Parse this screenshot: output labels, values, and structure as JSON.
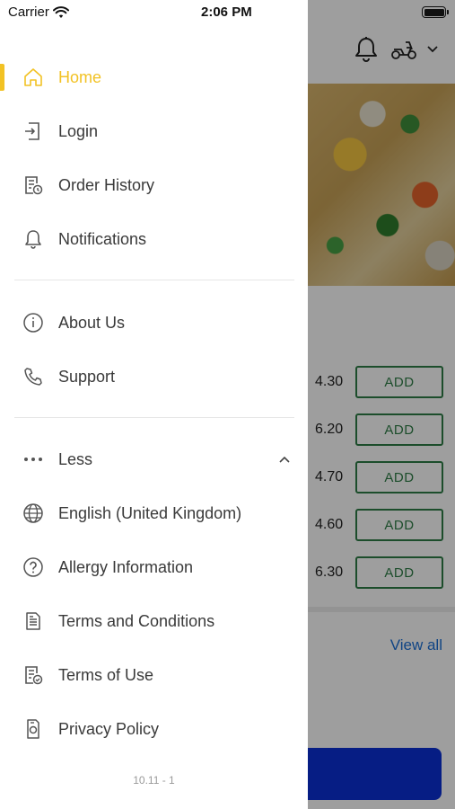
{
  "status_bar": {
    "carrier": "Carrier",
    "time": "2:06 PM"
  },
  "drawer": {
    "primary_items": [
      {
        "id": "home",
        "label": "Home",
        "icon": "home-icon",
        "active": true
      },
      {
        "id": "login",
        "label": "Login",
        "icon": "login-icon",
        "active": false
      },
      {
        "id": "order-history",
        "label": "Order History",
        "icon": "order-history-icon",
        "active": false
      },
      {
        "id": "notifications",
        "label": "Notifications",
        "icon": "bell-icon",
        "active": false
      }
    ],
    "secondary_items": [
      {
        "id": "about-us",
        "label": "About Us",
        "icon": "info-icon"
      },
      {
        "id": "support",
        "label": "Support",
        "icon": "phone-icon"
      }
    ],
    "less_label": "Less",
    "more_items": [
      {
        "id": "language",
        "label": "English (United Kingdom)",
        "icon": "globe-icon"
      },
      {
        "id": "allergy",
        "label": "Allergy Information",
        "icon": "question-icon"
      },
      {
        "id": "terms-conditions",
        "label": "Terms and Conditions",
        "icon": "document-icon"
      },
      {
        "id": "terms-of-use",
        "label": "Terms of Use",
        "icon": "document-check-icon"
      },
      {
        "id": "privacy-policy",
        "label": "Privacy Policy",
        "icon": "privacy-icon"
      }
    ],
    "version": "10.11 - 1",
    "accent_color": "#f2c224"
  },
  "background": {
    "menu_rows": [
      {
        "price": "4.30",
        "button": "ADD"
      },
      {
        "price": "6.20",
        "button": "ADD"
      },
      {
        "price": "4.70",
        "button": "ADD"
      },
      {
        "price": "4.60",
        "button": "ADD"
      },
      {
        "price": "6.30",
        "button": "ADD"
      }
    ],
    "view_all": "View all"
  }
}
